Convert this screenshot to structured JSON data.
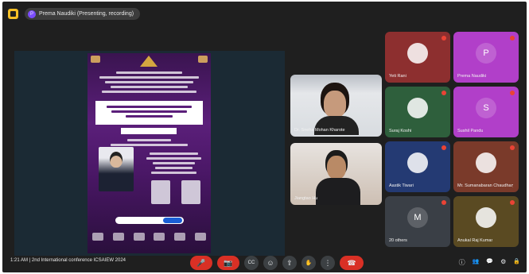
{
  "topbar": {
    "presenting_text": "Prema Naudiki (Presenting, recording)",
    "presenter_initial": "P"
  },
  "speaker_tiles": [
    {
      "name": "Dr. Sneha Mohan Kharote"
    },
    {
      "name": "Jiangtao Hu"
    }
  ],
  "participants": [
    {
      "name": "Yeti Rani",
      "initial": "",
      "color": "#8d2f2f"
    },
    {
      "name": "Prema Naudiki",
      "initial": "P",
      "color": "#b13fc9"
    },
    {
      "name": "Suraj Koshi",
      "initial": "",
      "color": "#2e5f3c"
    },
    {
      "name": "Sushil Pandu",
      "initial": "S",
      "color": "#b13fc9"
    },
    {
      "name": "Aastik Tiwari",
      "initial": "",
      "color": "#243a73"
    },
    {
      "name": "Mr. Sumanabaran Chaudhary",
      "initial": "",
      "color": "#7a3a2a"
    },
    {
      "name": "20 others",
      "initial": "M",
      "color": "#3a3f46"
    },
    {
      "name": "Anukal Raj Kumar",
      "initial": "",
      "color": "#5a4a22"
    }
  ],
  "bottombar": {
    "time": "1:21 AM",
    "separator": "|",
    "meeting_title": "2nd International conference ICSAIEW 2024",
    "icons": {
      "mic": "🎤",
      "camera": "📷",
      "captions": "CC",
      "emoji": "☺",
      "present": "⇪",
      "raise_hand": "✋",
      "more": "⋮",
      "end_call": "☎",
      "info": "ⓘ",
      "people": "👥",
      "chat": "💬",
      "activities": "⚙",
      "host": "🔒"
    }
  }
}
